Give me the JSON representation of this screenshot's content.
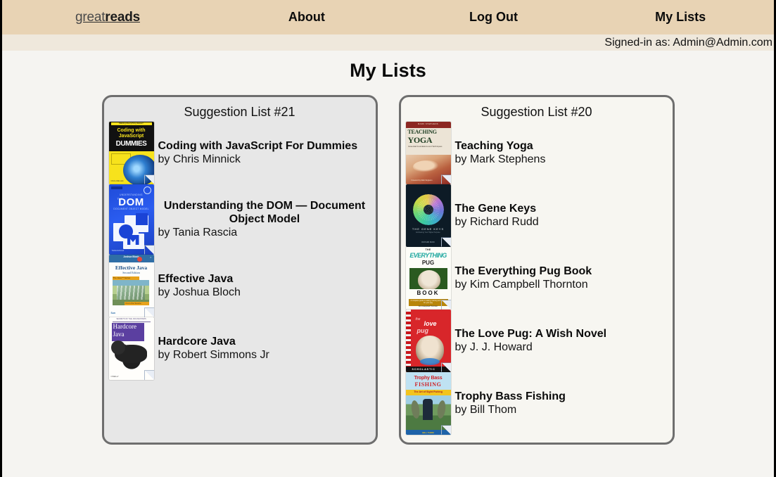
{
  "navbar": {
    "brand_light": "great",
    "brand_bold": "reads",
    "links": [
      {
        "label": "About",
        "name": "nav-link-about"
      },
      {
        "label": "Log Out",
        "name": "nav-link-logout"
      },
      {
        "label": "My Lists",
        "name": "nav-link-my-lists"
      }
    ]
  },
  "session": {
    "signed_in_text": "Signed-in as: Admin@Admin.com"
  },
  "page": {
    "title": "My Lists"
  },
  "lists": [
    {
      "title": "Suggestion List #21",
      "theme": "gray",
      "books": [
        {
          "title": "Coding with JavaScript For Dummies",
          "author": "by Chris Minnick",
          "cover": "coding-with-javascript-for-dummies-cover",
          "center_title": false
        },
        {
          "title": "Understanding the DOM — Document Object Model",
          "author": "by Tania Rascia",
          "cover": "understanding-the-dom-cover",
          "center_title": true
        },
        {
          "title": "Effective Java",
          "author": "by Joshua Bloch",
          "cover": "effective-java-cover",
          "center_title": false
        },
        {
          "title": "Hardcore Java",
          "author": "by Robert Simmons Jr",
          "cover": "hardcore-java-cover",
          "center_title": false
        }
      ]
    },
    {
      "title": "Suggestion List #20",
      "theme": "cream",
      "books": [
        {
          "title": "Teaching Yoga",
          "author": "by Mark Stephens",
          "cover": "teaching-yoga-cover",
          "center_title": false
        },
        {
          "title": "The Gene Keys",
          "author": "by Richard Rudd",
          "cover": "the-gene-keys-cover",
          "center_title": false
        },
        {
          "title": "The Everything Pug Book",
          "author": "by Kim Campbell Thornton",
          "cover": "the-everything-pug-book-cover",
          "center_title": false
        },
        {
          "title": "The Love Pug: A Wish Novel",
          "author": "by J. J. Howard",
          "cover": "the-love-pug-cover",
          "center_title": false
        },
        {
          "title": "Trophy Bass Fishing",
          "author": "by Bill Thom",
          "cover": "trophy-bass-fishing-cover",
          "center_title": false
        }
      ]
    }
  ],
  "cover_art": {
    "coding-with-javascript-for-dummies-cover": {
      "tag": "Making Everything Easier!",
      "line1": "Coding with",
      "line2": "JavaScript",
      "brand": "DUMMIES",
      "author": "Chris Minnick"
    },
    "understanding-the-dom-cover": {
      "badge": "DIGITALOCEAN",
      "sub": "UNDERSTANDING",
      "the": "THE",
      "big": "DOM",
      "caption": "DOCUMENT OBJECT MODEL",
      "footer": "TANIA RASCIA"
    },
    "effective-java-cover": {
      "top": "Joshua Bloch",
      "title": "Effective Java",
      "edition": "Second Edition",
      "band1": "The Java™ Series",
      "band2": "From the Source",
      "publisher": "Sun"
    },
    "hardcore-java-cover": {
      "top": "SECRETS OF THE JAVA MASTERS",
      "w1": "Hardcore",
      "w2": "Java",
      "footer": "O'REILLY"
    },
    "teaching-yoga-cover": {
      "top": "MARK STEPHENS",
      "line1": "TEACHING",
      "line2": "YOGA",
      "sub": "Essential Foundations and Techniques",
      "footer": "Foreword by Mark Singleton"
    },
    "the-gene-keys-cover": {
      "title": "THE GENE KEYS",
      "sub": "Embracing Your Higher Purpose",
      "author": "RICHARD RUDD"
    },
    "the-everything-pug-book-cover": {
      "the": "THE",
      "everything": "EVERYTHING",
      "pug": "PUG",
      "book": "BOOK",
      "band": "A complete guide to raising, training and caring for your pug",
      "author": "Kim Campbell Thornton"
    },
    "the-love-pug-cover": {
      "the": "the",
      "love": "love",
      "pug": "pug",
      "publisher": "SCHOLASTIC"
    },
    "trophy-bass-fishing-cover": {
      "line1": "Trophy Bass",
      "line2": "FISHING",
      "band": "The Art of Sight Fishing",
      "footer": "BILL THOM"
    }
  }
}
